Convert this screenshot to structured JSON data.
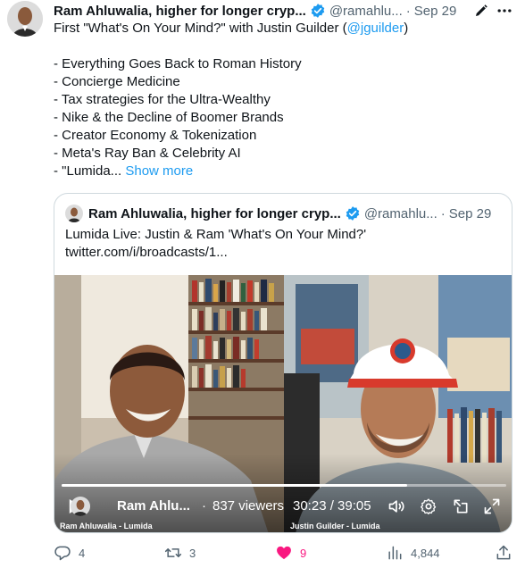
{
  "tweet": {
    "author_name": "Ram Ahluwalia, higher for longer cryp...",
    "handle": "@ramahlu...",
    "separator": "·",
    "date": "Sep 29",
    "lines": [
      "First \"What's On Your Mind?\" with Justin Guilder (",
      "",
      "- Everything Goes Back to Roman History",
      "- Concierge Medicine",
      "- Tax strategies for the Ultra-Wealthy",
      "- Nike & the Decline of Boomer Brands",
      "- Creator Economy & Tokenization",
      "- Meta's Ray Ban & Celebrity AI",
      "- \"Lumida... "
    ],
    "mention": "@jguilder",
    "mention_close": ")",
    "show_more": "Show more"
  },
  "quote": {
    "author_name": "Ram Ahluwalia, higher for longer cryp...",
    "handle": "@ramahlu...",
    "separator": "·",
    "date": "Sep 29",
    "line1": "Lumida Live: Justin & Ram 'What's On Your Mind?'",
    "line2": "twitter.com/i/broadcasts/1..."
  },
  "video": {
    "host_name": "Ram Ahlu...",
    "separator": "·",
    "viewers": "837 viewers",
    "time": "30:23 / 39:05",
    "progress": 0.777,
    "left_cam_label": "Ram Ahluwalia - Lumida",
    "right_cam_label": "Justin Guilder - Lumida"
  },
  "actions": {
    "replies": "4",
    "retweets": "3",
    "likes": "9",
    "views": "4,844"
  },
  "colors": {
    "link": "#1d9bf0",
    "verified": "#1d9bf0",
    "like": "#f91880",
    "muted": "#536471",
    "text": "#0f1419"
  },
  "icons": {
    "verified": "verified-badge-icon",
    "edit": "edit-pencil-icon",
    "more": "more-dots-icon",
    "play": "play-icon",
    "volume": "volume-icon",
    "settings": "gear-icon",
    "pip": "picture-in-picture-icon",
    "fullscreen": "fullscreen-icon",
    "reply": "reply-icon",
    "retweet": "retweet-icon",
    "like": "heart-icon",
    "views": "bar-chart-icon",
    "share": "share-icon"
  }
}
